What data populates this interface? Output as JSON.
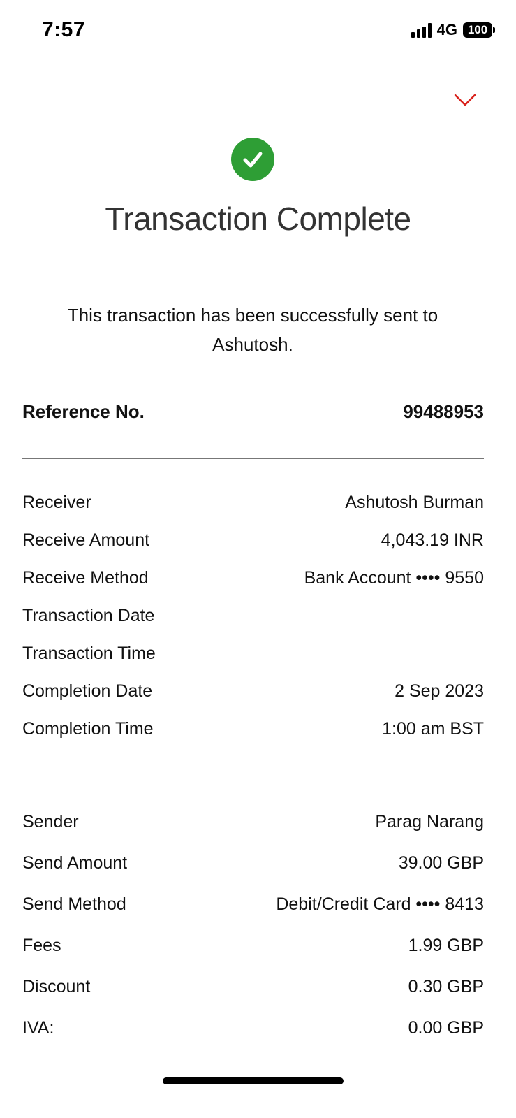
{
  "status_bar": {
    "time": "7:57",
    "network": "4G",
    "battery": "100"
  },
  "colors": {
    "success_green": "#2e9e35",
    "dismiss_red": "#d9221c"
  },
  "icons": {
    "dismiss": "chevron-down-icon",
    "success": "checkmark-circle-icon"
  },
  "header": {
    "title": "Transaction Complete",
    "message": "This transaction has been successfully sent to Ashutosh."
  },
  "reference": {
    "label": "Reference No.",
    "value": "99488953"
  },
  "receiver_section": [
    {
      "label": "Receiver",
      "value": "Ashutosh Burman"
    },
    {
      "label": "Receive Amount",
      "value": "4,043.19 INR"
    },
    {
      "label": "Receive Method",
      "value": "Bank Account •••• 9550"
    },
    {
      "label": "Transaction Date",
      "value": ""
    },
    {
      "label": "Transaction Time",
      "value": ""
    },
    {
      "label": "Completion Date",
      "value": "2 Sep 2023"
    },
    {
      "label": "Completion Time",
      "value": "1:00 am BST"
    }
  ],
  "sender_section": [
    {
      "label": "Sender",
      "value": "Parag Narang"
    },
    {
      "label": "Send Amount",
      "value": "39.00 GBP"
    },
    {
      "label": "Send Method",
      "value": "Debit/Credit Card •••• 8413"
    },
    {
      "label": "Fees",
      "value": "1.99 GBP"
    },
    {
      "label": "Discount",
      "value": "0.30 GBP"
    },
    {
      "label": "IVA:",
      "value": "0.00 GBP"
    }
  ]
}
